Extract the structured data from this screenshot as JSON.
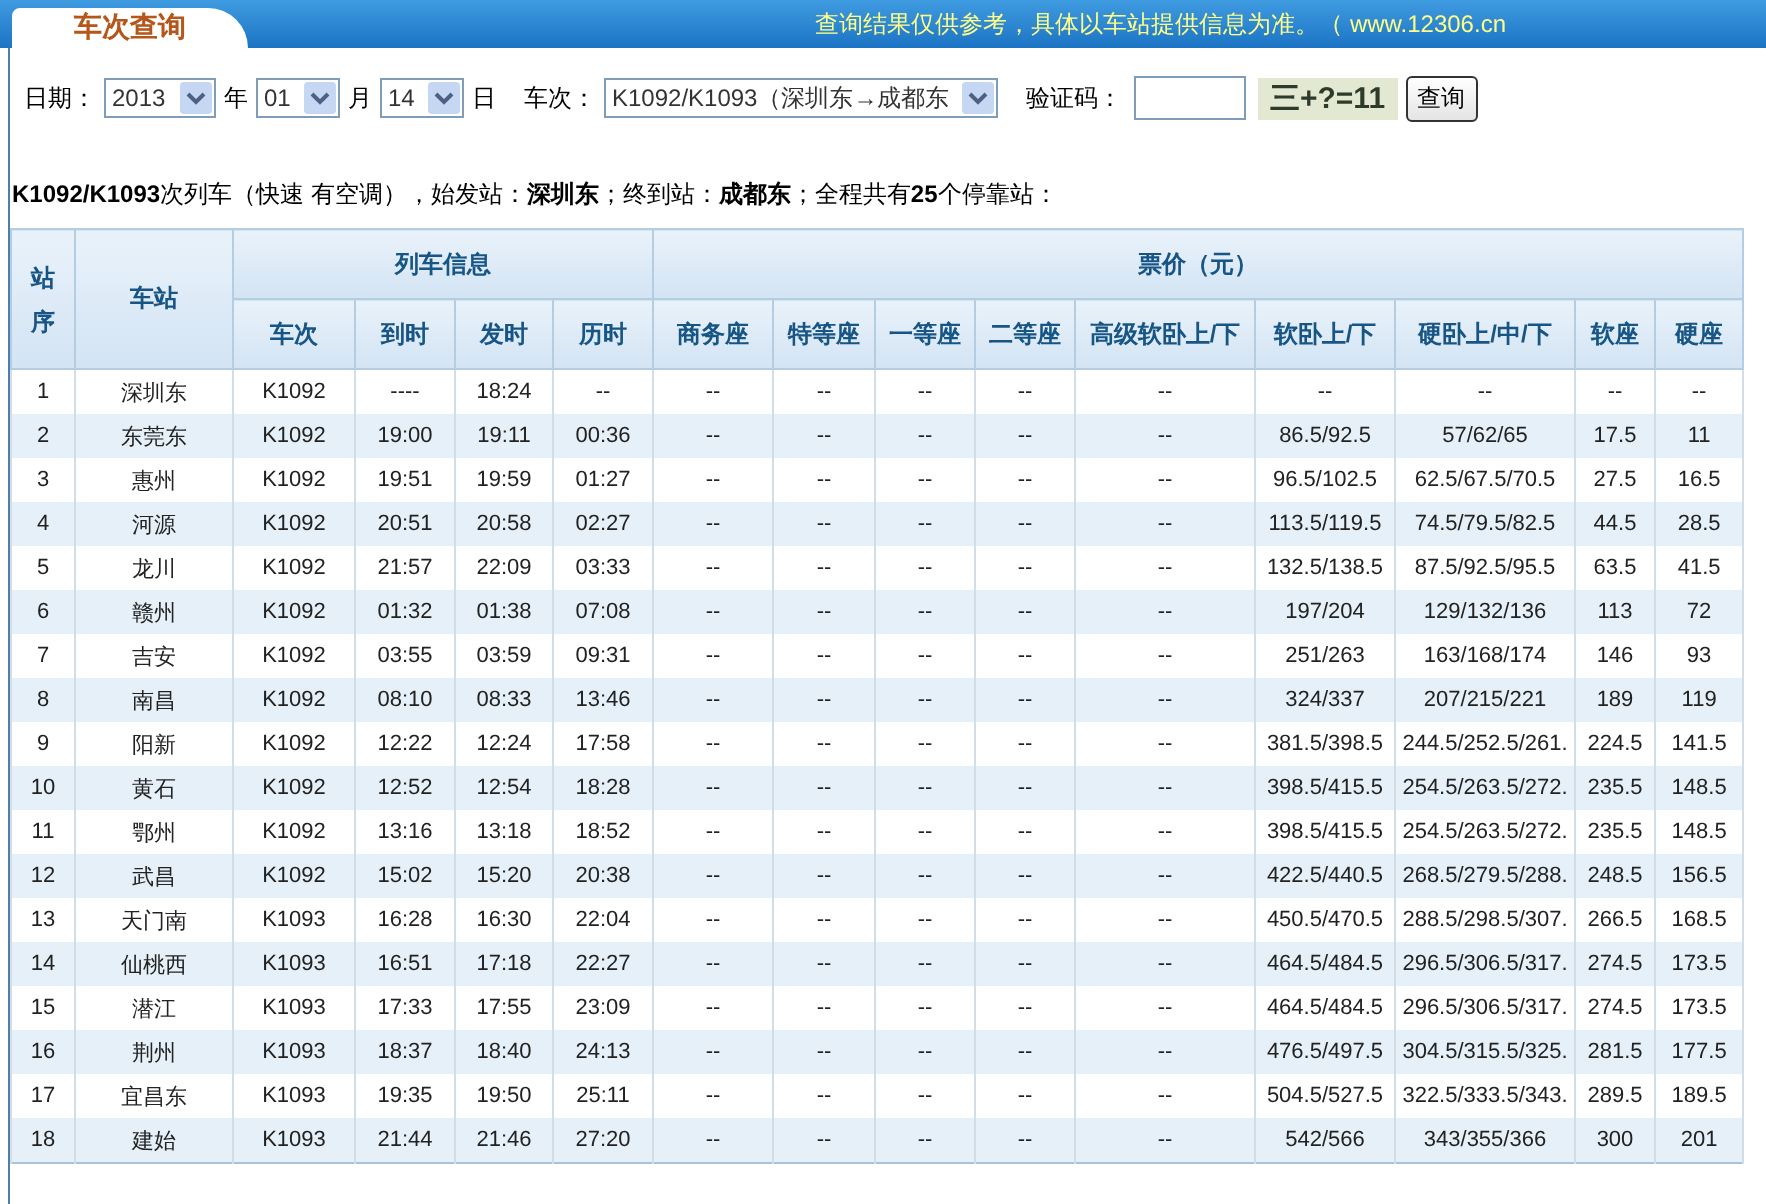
{
  "header": {
    "tab_title": "车次查询",
    "notice": "查询结果仅供参考，具体以车站提供信息为准。（ www.12306.cn"
  },
  "form": {
    "date_label": "日期：",
    "year": {
      "value": "2013"
    },
    "year_unit": "年",
    "month": {
      "value": "01"
    },
    "month_unit": "月",
    "day": {
      "value": "14"
    },
    "day_unit": "日",
    "train_label": "车次：",
    "train": {
      "value": "K1092/K1093（深圳东→成都东"
    },
    "captcha_label": "验证码：",
    "captcha_image": "三+?=11",
    "submit": "查询"
  },
  "summary": "**K1092/K1093**次列车（快速 有空调），始发站：**深圳东**；终到站：**成都东**；全程共有**25**个停靠站：",
  "table": {
    "header_groups": [
      {
        "label": "列车信息"
      },
      {
        "label": "票价（元）"
      }
    ],
    "columns": [
      {
        "label": "站序",
        "kind": "single"
      },
      {
        "label": "车站",
        "kind": "single"
      },
      {
        "label": "车次",
        "kind": "group_start"
      },
      {
        "label": "到时",
        "kind": "in_group"
      },
      {
        "label": "发时",
        "kind": "in_group"
      },
      {
        "label": "历时",
        "kind": "in_group"
      },
      {
        "label": "商务座",
        "kind": "group_start"
      },
      {
        "label": "特等座",
        "kind": "in_group"
      },
      {
        "label": "一等座",
        "kind": "in_group"
      },
      {
        "label": "二等座",
        "kind": "in_group"
      },
      {
        "label": "高级软卧上/下",
        "kind": "in_group"
      },
      {
        "label": "软卧上/下",
        "kind": "in_group"
      },
      {
        "label": "硬卧上/中/下",
        "kind": "in_group"
      },
      {
        "label": "软座",
        "kind": "in_group"
      },
      {
        "label": "硬座",
        "kind": "in_group"
      }
    ],
    "rows": [
      [
        "1",
        "深圳东",
        "K1092",
        "----",
        "18:24",
        "--",
        "--",
        "--",
        "--",
        "--",
        "--",
        "--",
        "--",
        "--",
        "--"
      ],
      [
        "2",
        "东莞东",
        "K1092",
        "19:00",
        "19:11",
        "00:36",
        "--",
        "--",
        "--",
        "--",
        "--",
        "86.5/92.5",
        "57/62/65",
        "17.5",
        "11"
      ],
      [
        "3",
        "惠州",
        "K1092",
        "19:51",
        "19:59",
        "01:27",
        "--",
        "--",
        "--",
        "--",
        "--",
        "96.5/102.5",
        "62.5/67.5/70.5",
        "27.5",
        "16.5"
      ],
      [
        "4",
        "河源",
        "K1092",
        "20:51",
        "20:58",
        "02:27",
        "--",
        "--",
        "--",
        "--",
        "--",
        "113.5/119.5",
        "74.5/79.5/82.5",
        "44.5",
        "28.5"
      ],
      [
        "5",
        "龙川",
        "K1092",
        "21:57",
        "22:09",
        "03:33",
        "--",
        "--",
        "--",
        "--",
        "--",
        "132.5/138.5",
        "87.5/92.5/95.5",
        "63.5",
        "41.5"
      ],
      [
        "6",
        "赣州",
        "K1092",
        "01:32",
        "01:38",
        "07:08",
        "--",
        "--",
        "--",
        "--",
        "--",
        "197/204",
        "129/132/136",
        "113",
        "72"
      ],
      [
        "7",
        "吉安",
        "K1092",
        "03:55",
        "03:59",
        "09:31",
        "--",
        "--",
        "--",
        "--",
        "--",
        "251/263",
        "163/168/174",
        "146",
        "93"
      ],
      [
        "8",
        "南昌",
        "K1092",
        "08:10",
        "08:33",
        "13:46",
        "--",
        "--",
        "--",
        "--",
        "--",
        "324/337",
        "207/215/221",
        "189",
        "119"
      ],
      [
        "9",
        "阳新",
        "K1092",
        "12:22",
        "12:24",
        "17:58",
        "--",
        "--",
        "--",
        "--",
        "--",
        "381.5/398.5",
        "244.5/252.5/261.",
        "224.5",
        "141.5"
      ],
      [
        "10",
        "黄石",
        "K1092",
        "12:52",
        "12:54",
        "18:28",
        "--",
        "--",
        "--",
        "--",
        "--",
        "398.5/415.5",
        "254.5/263.5/272.",
        "235.5",
        "148.5"
      ],
      [
        "11",
        "鄂州",
        "K1092",
        "13:16",
        "13:18",
        "18:52",
        "--",
        "--",
        "--",
        "--",
        "--",
        "398.5/415.5",
        "254.5/263.5/272.",
        "235.5",
        "148.5"
      ],
      [
        "12",
        "武昌",
        "K1092",
        "15:02",
        "15:20",
        "20:38",
        "--",
        "--",
        "--",
        "--",
        "--",
        "422.5/440.5",
        "268.5/279.5/288.",
        "248.5",
        "156.5"
      ],
      [
        "13",
        "天门南",
        "K1093",
        "16:28",
        "16:30",
        "22:04",
        "--",
        "--",
        "--",
        "--",
        "--",
        "450.5/470.5",
        "288.5/298.5/307.",
        "266.5",
        "168.5"
      ],
      [
        "14",
        "仙桃西",
        "K1093",
        "16:51",
        "17:18",
        "22:27",
        "--",
        "--",
        "--",
        "--",
        "--",
        "464.5/484.5",
        "296.5/306.5/317.",
        "274.5",
        "173.5"
      ],
      [
        "15",
        "潜江",
        "K1093",
        "17:33",
        "17:55",
        "23:09",
        "--",
        "--",
        "--",
        "--",
        "--",
        "464.5/484.5",
        "296.5/306.5/317.",
        "274.5",
        "173.5"
      ],
      [
        "16",
        "荆州",
        "K1093",
        "18:37",
        "18:40",
        "24:13",
        "--",
        "--",
        "--",
        "--",
        "--",
        "476.5/497.5",
        "304.5/315.5/325.",
        "281.5",
        "177.5"
      ],
      [
        "17",
        "宜昌东",
        "K1093",
        "19:35",
        "19:50",
        "25:11",
        "--",
        "--",
        "--",
        "--",
        "--",
        "504.5/527.5",
        "322.5/333.5/343.",
        "289.5",
        "189.5"
      ],
      [
        "18",
        "建始",
        "K1093",
        "21:44",
        "21:46",
        "27:20",
        "--",
        "--",
        "--",
        "--",
        "--",
        "542/566",
        "343/355/366",
        "300",
        "201"
      ]
    ]
  }
}
